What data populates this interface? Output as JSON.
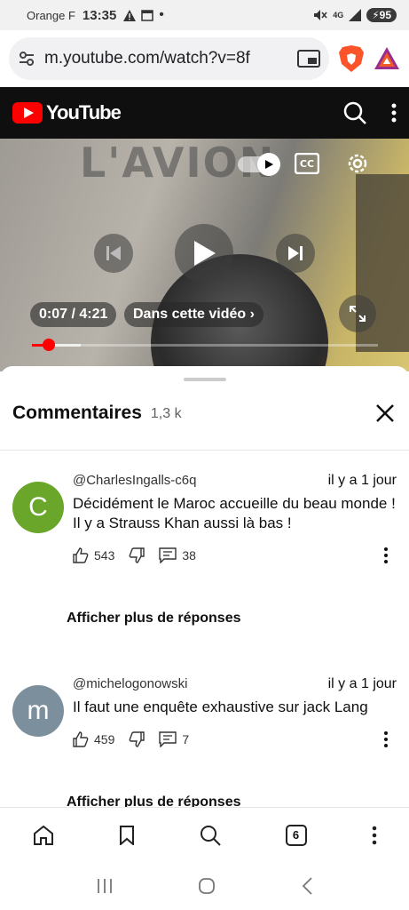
{
  "status_bar": {
    "carrier": "Orange F",
    "time": "13:35",
    "network": "4G",
    "battery": "95"
  },
  "browser": {
    "url": "m.youtube.com/watch?v=8f"
  },
  "youtube": {
    "logo_text": "YouTube"
  },
  "video": {
    "overlay_text": "L'AVION",
    "time_display": "0:07 / 4:21",
    "chapters_label": "Dans cette vidéo",
    "progress": 0.027
  },
  "comments_panel": {
    "title": "Commentaires",
    "count": "1,3 k",
    "comments": [
      {
        "avatar_letter": "C",
        "avatar_color": "#6aa62a",
        "author": "@CharlesIngalls-c6q",
        "time": "il y a 1 jour",
        "text": "Décidément le Maroc accueille du beau monde ! Il y a Strauss Khan aussi  là bas !",
        "likes": "543",
        "replies": "38",
        "more_replies": "Afficher plus de réponses"
      },
      {
        "avatar_letter": "m",
        "avatar_color": "#7b8f9c",
        "author": "@michelogonowski",
        "time": "il y a 1 jour",
        "text": "Il faut une enquête exhaustive sur jack Lang",
        "likes": "459",
        "replies": "7",
        "more_replies": "Afficher plus de réponses"
      }
    ]
  },
  "bottom_nav": {
    "tabs_count": "6"
  }
}
